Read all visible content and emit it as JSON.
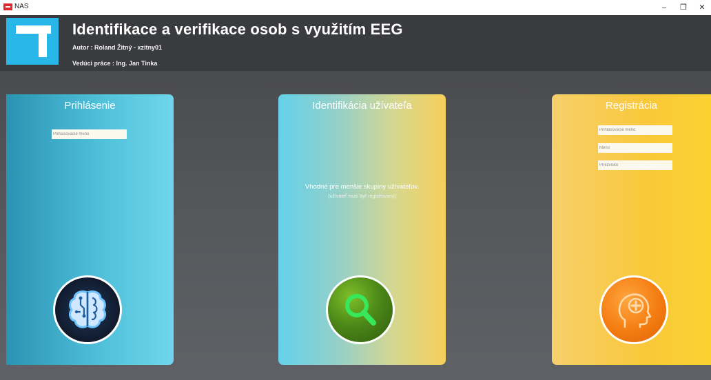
{
  "window": {
    "title": "NAS",
    "minimize": "–",
    "restore": "❐",
    "close": "✕"
  },
  "header": {
    "title": "Identifikace a verifikace osob s využitím EEG",
    "author": "Autor : Roland Žitný - xzitny01",
    "advisor": "Vedúci práce : Ing. Jan Tinka"
  },
  "cards": {
    "login": {
      "title": "Prihlásenie",
      "username_placeholder": "Prihlasovacie meno",
      "button_icon": "brain-circuit-icon"
    },
    "identification": {
      "title": "Identifikácia užívateľa",
      "description": "Vhodné pre menšie skupiny užívateľov.",
      "note": "(užívateľ musí byť registrovaný)",
      "button_icon": "magnifier-icon"
    },
    "registration": {
      "title": "Registrácia",
      "username_placeholder": "Prihlasovacie meno",
      "name_placeholder": "Meno",
      "surname_placeholder": "Priezvisko",
      "button_icon": "head-plus-icon"
    }
  },
  "colors": {
    "header_bg": "#3a3b3e",
    "logo_bg": "#29b6e8",
    "login_card": "#4fbfd9",
    "ident_card_start": "#64d1ea",
    "ident_card_end": "#f6cf5a",
    "reg_card": "#f9c839"
  }
}
